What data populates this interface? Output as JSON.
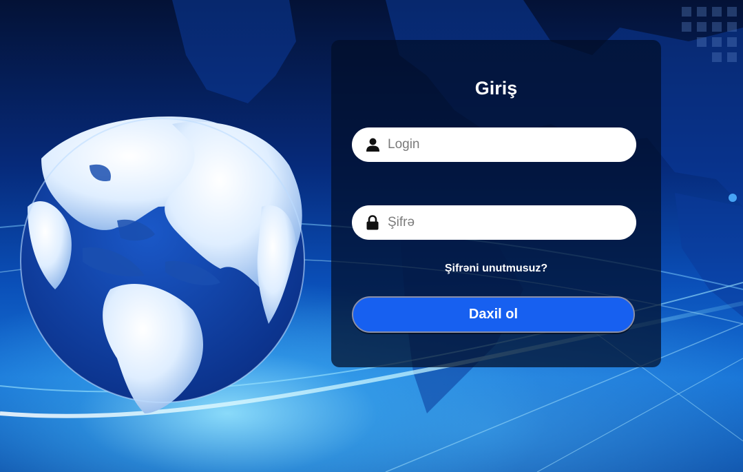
{
  "login_form": {
    "title": "Giriş",
    "login_placeholder": "Login",
    "login_value": "",
    "password_placeholder": "Şifrə",
    "password_value": "",
    "forgot_password_label": "Şifrəni unutmusuz?",
    "submit_label": "Daxil ol",
    "user_icon": "user-icon",
    "lock_icon": "lock-icon"
  },
  "background": {
    "image": "globe-world-map-image"
  },
  "colors": {
    "submit_button": "#1760f0",
    "card_background": "#020e28",
    "page_background": "#0a4fb8"
  }
}
